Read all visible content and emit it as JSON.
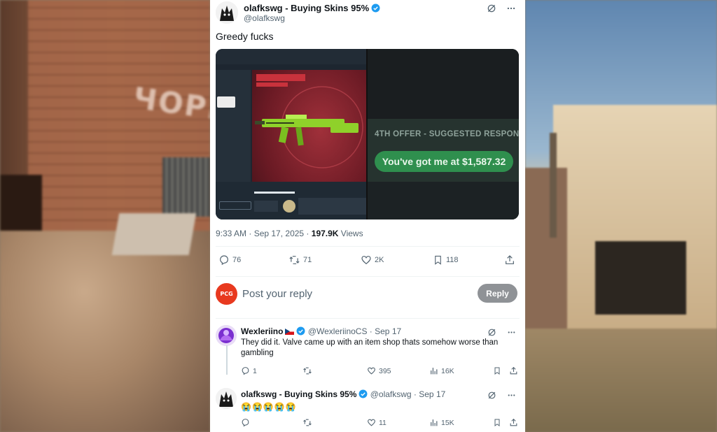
{
  "background": {
    "left_sign_text": "ЧОРН"
  },
  "tweet": {
    "display_name": "olafkswg - Buying Skins 95%",
    "handle": "@olafkswg",
    "text": "Greedy fucks",
    "timestamp": "9:33 AM · Sep 17, 2025 · ",
    "views_count": "197.9K",
    "views_label": " Views",
    "media": {
      "right_offer_heading": "4TH OFFER - SUGGESTED RESPON",
      "right_offer_text": "You've got me at $1,587.32"
    },
    "stats": {
      "replies": "76",
      "reposts": "71",
      "likes": "2K",
      "bookmarks": "118"
    },
    "accent_color": "#1d9bf0"
  },
  "reply_box": {
    "avatar_text": "PCG",
    "placeholder": "Post your reply",
    "button_label": "Reply"
  },
  "replies": [
    {
      "display_name": "Wexleriino",
      "handle_time": "@WexleriinoCS · Sep 17",
      "text": "They did it. Valve came up with an item shop thats somehow worse than gambling",
      "replies": "1",
      "reposts": "",
      "likes": "395",
      "views": "16K"
    },
    {
      "display_name": "olafkswg - Buying Skins 95%",
      "handle_time": "@olafkswg · Sep 17",
      "text": "😭😭😭😭😭",
      "replies": "",
      "reposts": "",
      "likes": "11",
      "views": "15K"
    }
  ]
}
